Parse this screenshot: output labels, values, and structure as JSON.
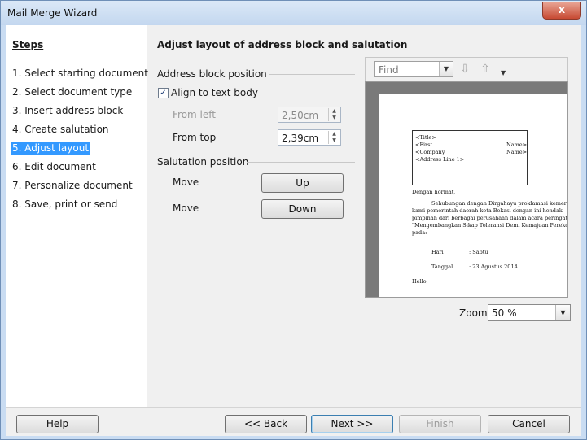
{
  "window": {
    "title": "Mail Merge Wizard",
    "close_glyph": "x"
  },
  "steps": {
    "title": "Steps",
    "items": [
      "1. Select starting document",
      "2. Select document type",
      "3. Insert address block",
      "4. Create salutation",
      "5. Adjust layout",
      "6. Edit document",
      "7. Personalize document",
      "8. Save, print or send"
    ],
    "active_index": 4
  },
  "main": {
    "heading": "Adjust layout of address block and salutation",
    "address_block": {
      "label": "Address block position",
      "align_checkbox": {
        "label": "Align to text body",
        "checked": true
      },
      "from_left": {
        "label": "From left",
        "value": "2,50cm",
        "enabled": false
      },
      "from_top": {
        "label": "From top",
        "value": "2,39cm",
        "enabled": true
      }
    },
    "salutation": {
      "label": "Salutation position",
      "move_up": {
        "label": "Move",
        "button": "Up"
      },
      "move_down": {
        "label": "Move",
        "button": "Down"
      }
    }
  },
  "preview": {
    "find_placeholder": "Find",
    "down_icon": "down-arrow-icon",
    "up_icon": "up-arrow-icon",
    "document_lines": {
      "title": "<Title>",
      "first": "<First",
      "name1": "Name>",
      "company": "<Company",
      "name2": "Name>",
      "address": "<Address Line 1>",
      "greeting": "Dengan hormat,",
      "body1": "Sehubungan dengan Dirgahayu proklamasi kemerd",
      "body2": "kami pemerintah daerah kota Bekasi dengan ini hendak",
      "body3": "pimpinan dari berbagai perusahaan dalam acara peringat",
      "body4": "\"Mengembangkan Sikap Toleransi Demi Kemajuan Pereko",
      "body5": "pada:",
      "hari_label": "Hari",
      "hari_value": ": Sabtu",
      "tanggal_label": "Tanggal",
      "tanggal_value": ": 23 Agustus 2014",
      "closing": "Hello,"
    },
    "zoom": {
      "label": "Zoom",
      "value": "50 %"
    }
  },
  "footer": {
    "help": "Help",
    "back": "<< Back",
    "next": "Next >>",
    "finish": "Finish",
    "cancel": "Cancel"
  }
}
